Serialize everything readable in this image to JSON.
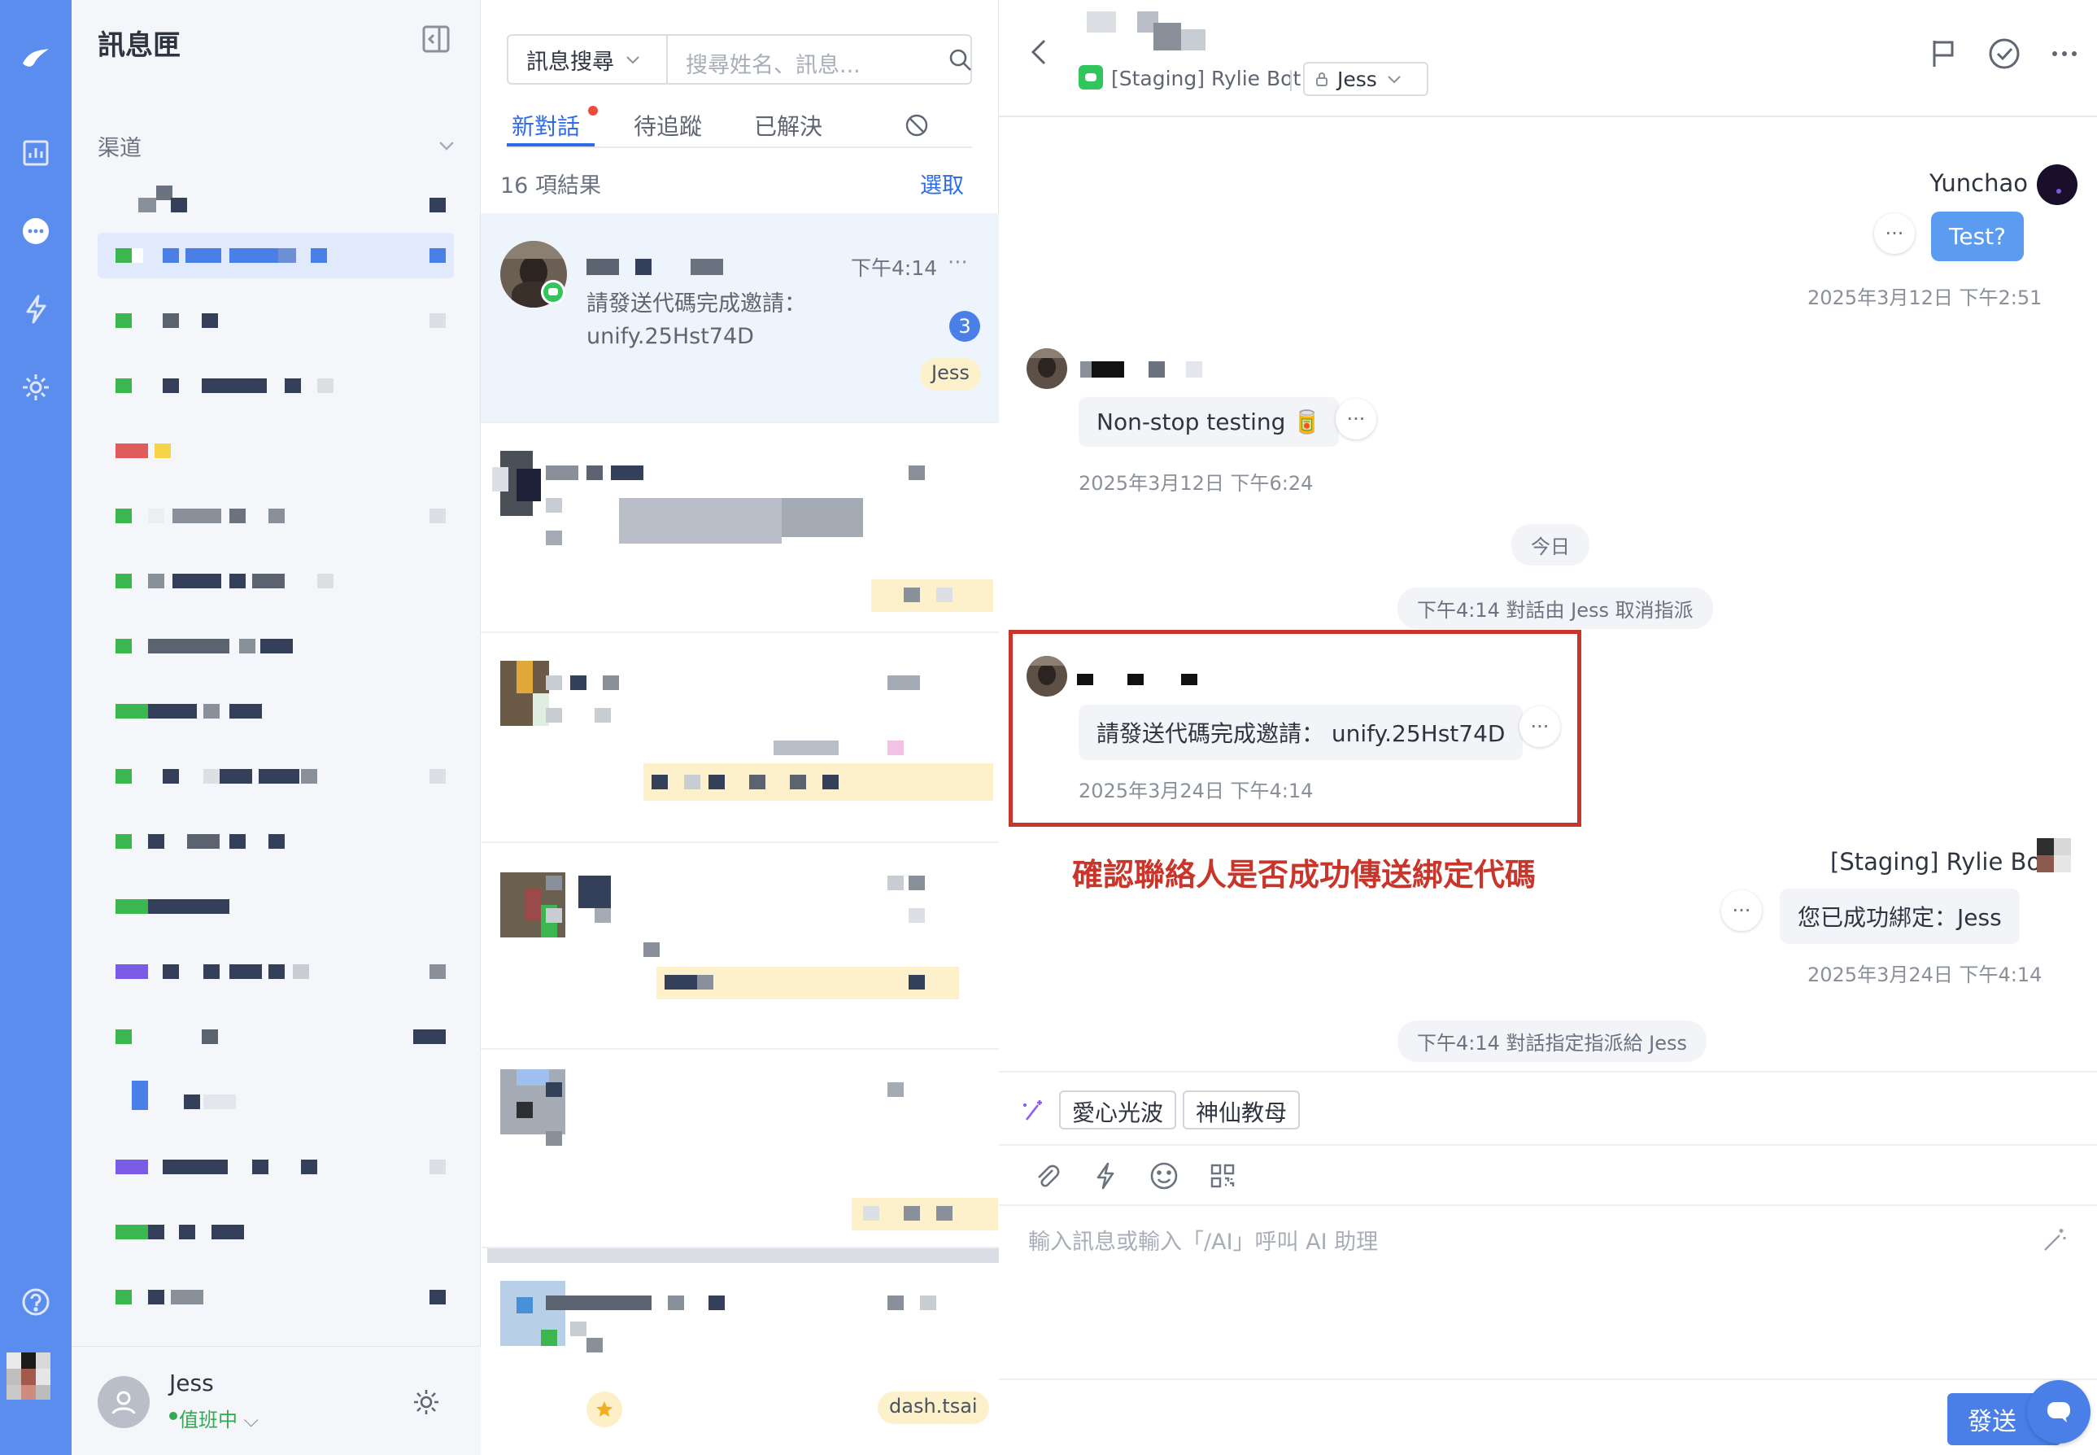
{
  "inbox": {
    "title": "訊息匣",
    "channels_label": "渠道",
    "user": {
      "name": "Jess",
      "status": "值班中"
    }
  },
  "list": {
    "search_scope": "訊息搜尋",
    "search_placeholder": "搜尋姓名、訊息...",
    "tabs": [
      "新對話",
      "待追蹤",
      "已解決"
    ],
    "result_count": "16 項結果",
    "select_label": "選取",
    "selected_conversation": {
      "time": "下午4:14",
      "preview_line1": "請發送代碼完成邀請：",
      "preview_line2": "unify.25Hst74D",
      "unread": "3",
      "assignee": "Jess"
    },
    "last_assignee": "dash.tsai"
  },
  "chat": {
    "channel": "[Staging] Rylie Bot",
    "assignee": "Jess",
    "messages": {
      "m1_name": "Yunchao",
      "m1_text": "Test?",
      "m1_time": "2025年3月12日 下午2:51",
      "m2_text": "Non-stop testing 🥫",
      "m2_time": "2025年3月12日 下午6:24",
      "today": "今日",
      "sys1": "下午4:14 對話由 Jess 取消指派",
      "m3_text": "請發送代碼完成邀請： unify.25Hst74D",
      "m3_time": "2025年3月24日 下午4:14",
      "annotation": "確認聯絡人是否成功傳送綁定代碼",
      "m4_name": "[Staging] Rylie Bot",
      "m4_text": "您已成功綁定：Jess",
      "m4_time": "2025年3月24日 下午4:14",
      "sys2": "下午4:14 對話指定指派給 Jess"
    },
    "quick_replies": [
      "愛心光波",
      "神仙教母"
    ],
    "input_placeholder": "輸入訊息或輸入「/AI」呼叫 AI 助理",
    "send_label": "發送"
  }
}
